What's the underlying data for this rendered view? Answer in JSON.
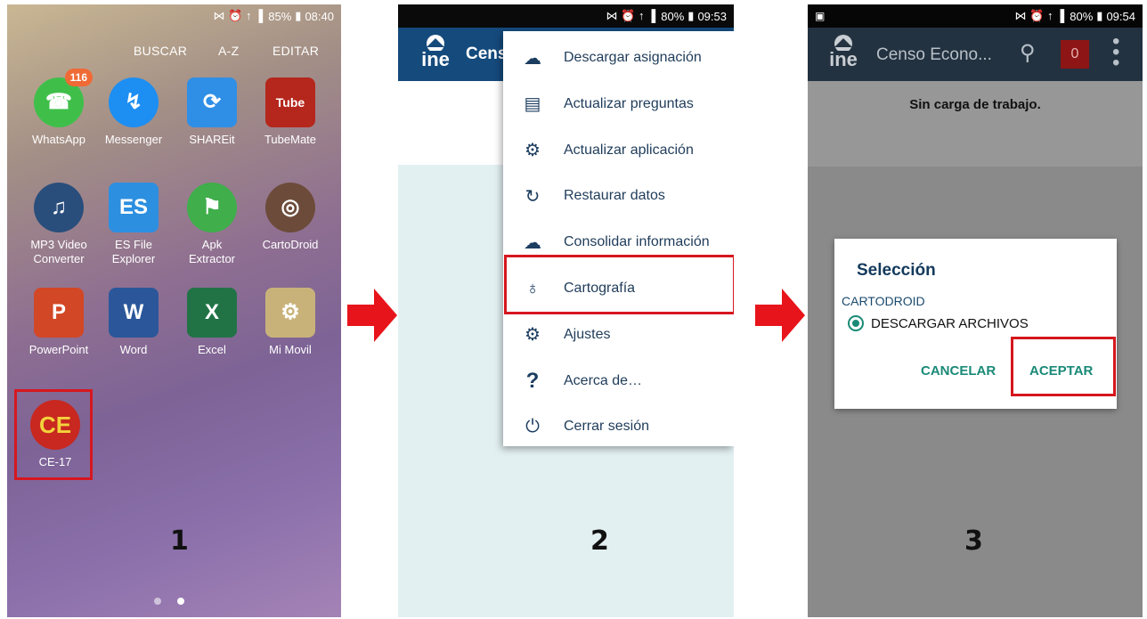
{
  "panel1": {
    "status": {
      "icons": "⋈ ⏰ ↑ ▐",
      "battery": "85%",
      "time": "08:40"
    },
    "top_buttons": [
      "BUSCAR",
      "A-Z",
      "EDITAR"
    ],
    "apps": [
      {
        "label": "WhatsApp",
        "badge": "116",
        "icon": "whatsapp-icon",
        "glyph": "☎",
        "color": "#3fbf4a"
      },
      {
        "label": "Messenger",
        "icon": "messenger-icon",
        "glyph": "↯",
        "color": "#1d8ef2"
      },
      {
        "label": "SHAREit",
        "icon": "shareit-icon",
        "glyph": "⟳",
        "color": "#2f8fe6"
      },
      {
        "label": "TubeMate",
        "icon": "tubemate-icon",
        "glyph": "Tube",
        "color": "#b5271d"
      },
      {
        "label": "MP3 Video Converter",
        "icon": "mp3-converter-icon",
        "glyph": "♫",
        "color": "#2a4e7c"
      },
      {
        "label": "ES File Explorer",
        "icon": "es-file-explorer-icon",
        "glyph": "ES",
        "color": "#2d8fe0"
      },
      {
        "label": "Apk Extractor",
        "icon": "apk-extractor-icon",
        "glyph": "⚑",
        "color": "#3fae4b"
      },
      {
        "label": "CartoDroid",
        "icon": "cartodroid-icon",
        "glyph": "◎",
        "color": "#6d4b3a"
      },
      {
        "label": "PowerPoint",
        "icon": "powerpoint-icon",
        "glyph": "P",
        "color": "#d24726"
      },
      {
        "label": "Word",
        "icon": "word-icon",
        "glyph": "W",
        "color": "#2b579a"
      },
      {
        "label": "Excel",
        "icon": "excel-icon",
        "glyph": "X",
        "color": "#217346"
      },
      {
        "label": "Mi Movil",
        "icon": "sim-settings-icon",
        "glyph": "⚙",
        "color": "#c9b27a"
      },
      {
        "label": "CE-17",
        "icon": "ce17-icon",
        "glyph": "CE",
        "color": "#c8281f"
      }
    ],
    "step": "1"
  },
  "panel2": {
    "status": {
      "icons": "⋈ ⏰ ↑ ▐",
      "battery": "80%",
      "time": "09:53"
    },
    "logo": "ine",
    "title_partial": "Cens",
    "menu": [
      {
        "label": "Descargar asignación",
        "icon": "cloud-download-icon",
        "glyph": "☁"
      },
      {
        "label": "Actualizar preguntas",
        "icon": "clipboard-sync-icon",
        "glyph": "▤"
      },
      {
        "label": "Actualizar aplicación",
        "icon": "android-update-icon",
        "glyph": "⚙"
      },
      {
        "label": "Restaurar datos",
        "icon": "restore-icon",
        "glyph": "↻"
      },
      {
        "label": "Consolidar información",
        "icon": "cloud-upload-icon",
        "glyph": "☁"
      },
      {
        "label": "Cartografía",
        "icon": "globe-pin-icon",
        "glyph": "♁"
      },
      {
        "label": "Ajustes",
        "icon": "gear-icon",
        "glyph": "⚙"
      },
      {
        "label": "Acerca de…",
        "icon": "question-icon",
        "glyph": "?"
      },
      {
        "label": "Cerrar sesión",
        "icon": "power-icon",
        "glyph": "⏻"
      }
    ],
    "step": "2"
  },
  "panel3": {
    "status": {
      "left_icon": "▣",
      "icons": "⋈ ⏰ ↑ ▐",
      "battery": "80%",
      "time": "09:54"
    },
    "logo": "ine",
    "title": "Censo Econo...",
    "counter": "0",
    "subtitle": "Sin carga de trabajo.",
    "dialog": {
      "title": "Selección",
      "section": "CARTODROID",
      "option": "DESCARGAR ARCHIVOS",
      "cancel": "CANCELAR",
      "accept": "ACEPTAR"
    },
    "step": "3"
  },
  "colors": {
    "highlight": "#d6171e",
    "arrow": "#e8141b",
    "appbar": "#154a7c",
    "teal": "#1a8a77"
  }
}
